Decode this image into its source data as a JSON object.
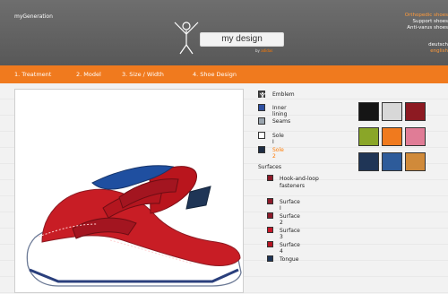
{
  "header": {
    "brand": "myGeneration",
    "logo_text": "my design",
    "logo_by": "by",
    "logo_brand": "adidas",
    "right_links": [
      "Orthopedic shoes",
      "Support shoes",
      "Anti-varus shoes"
    ],
    "languages": [
      "deutsch",
      "english"
    ]
  },
  "nav": {
    "items": [
      "1. Treatment",
      "2. Model",
      "3. Size / Width",
      "4. Shoe Design"
    ]
  },
  "options": [
    {
      "label": "Emblem",
      "color": "#444444",
      "type": "emblem"
    },
    {
      "label": "Inner lining",
      "color": "#2d4fa0"
    },
    {
      "label": "Seams",
      "color": "#9aa4ad"
    },
    {
      "label": "Sole I",
      "color": "#ffffff"
    },
    {
      "label": "Sole 2",
      "color": "#1f2d44",
      "active": true
    }
  ],
  "surfaces_label": "Surfaces",
  "surfaces": [
    {
      "label": "Hook-and-loop fasteners",
      "color": "#8d1a2a"
    },
    {
      "label": "Surface I",
      "color": "#8d1a2a"
    },
    {
      "label": "Surface 2",
      "color": "#8d1a2a"
    },
    {
      "label": "Surface 3",
      "color": "#c8182a"
    },
    {
      "label": "Surface 4",
      "color": "#b41422"
    },
    {
      "label": "Tongue",
      "color": "#1f3556"
    }
  ],
  "palette": {
    "rows": [
      [
        "#151515",
        "#d8d8d8",
        "#8d1a22"
      ],
      [
        "#8aa628",
        "#f07a1e",
        "#e07c96"
      ],
      [
        "#1f3556",
        "#2d5b9a",
        "#d08a3a"
      ]
    ]
  }
}
